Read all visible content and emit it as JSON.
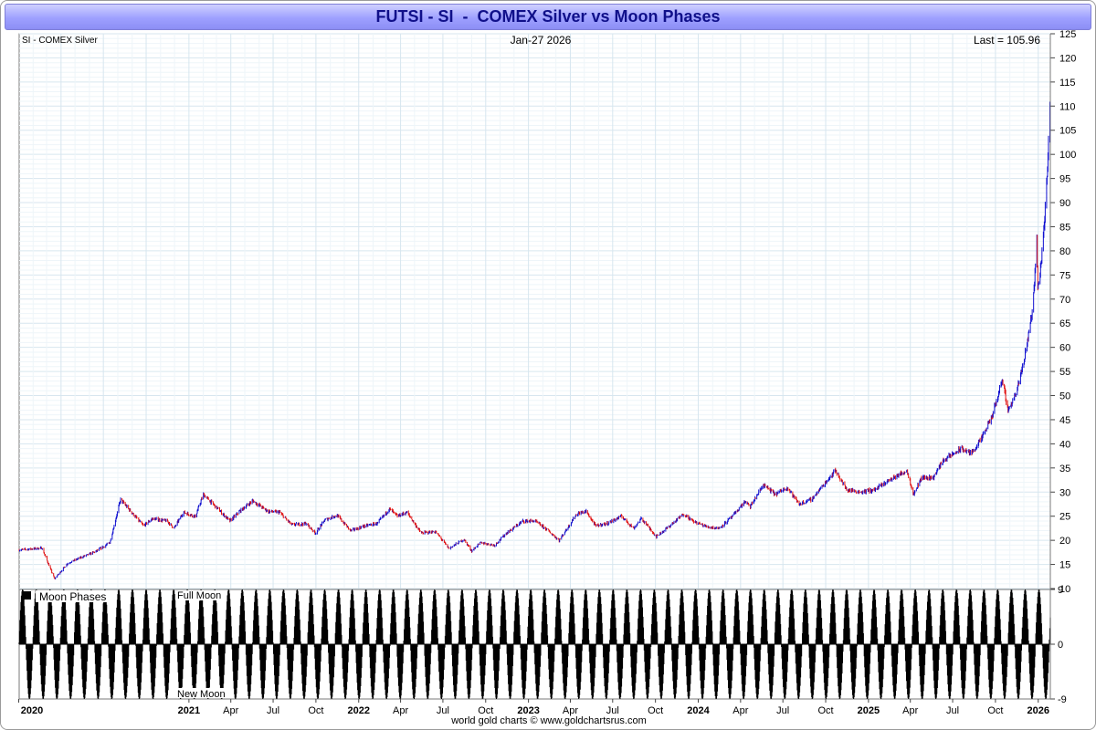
{
  "title": "FUTSI - SI  -  COMEX Silver vs Moon Phases",
  "footer": "world gold charts © www.goldchartsrus.com",
  "chart_data": [
    {
      "type": "line",
      "header_left": "SI  -  COMEX Silver",
      "header_center": "Jan-27  2026",
      "header_right": "Last = 105.96",
      "x_range": [
        "2020-01-02",
        "2026-01-27"
      ],
      "ylim": [
        10,
        125
      ],
      "y_ticks": [
        10,
        15,
        20,
        25,
        30,
        35,
        40,
        45,
        50,
        55,
        60,
        65,
        70,
        75,
        80,
        85,
        90,
        95,
        100,
        105,
        110,
        115,
        120,
        125
      ],
      "grid": true,
      "series_colors": {
        "up": "#1010d0",
        "down": "#e01010"
      },
      "series": [
        {
          "points": [
            [
              "2020-01-02",
              18.0
            ],
            [
              "2020-02-20",
              18.4
            ],
            [
              "2020-03-18",
              12.0
            ],
            [
              "2020-04-15",
              15.2
            ],
            [
              "2020-05-15",
              16.5
            ],
            [
              "2020-06-15",
              17.7
            ],
            [
              "2020-07-15",
              19.5
            ],
            [
              "2020-08-07",
              28.5
            ],
            [
              "2020-08-20",
              27.0
            ],
            [
              "2020-09-25",
              23.0
            ],
            [
              "2020-10-15",
              24.5
            ],
            [
              "2020-11-15",
              24.0
            ],
            [
              "2020-11-30",
              22.5
            ],
            [
              "2020-12-20",
              25.8
            ],
            [
              "2021-01-15",
              25.0
            ],
            [
              "2021-02-01",
              29.5
            ],
            [
              "2021-02-22",
              27.5
            ],
            [
              "2021-03-30",
              24.0
            ],
            [
              "2021-04-20",
              26.0
            ],
            [
              "2021-05-18",
              28.2
            ],
            [
              "2021-06-20",
              26.0
            ],
            [
              "2021-07-15",
              25.8
            ],
            [
              "2021-08-10",
              23.2
            ],
            [
              "2021-09-10",
              23.5
            ],
            [
              "2021-09-30",
              21.5
            ],
            [
              "2021-10-20",
              24.2
            ],
            [
              "2021-11-15",
              25.2
            ],
            [
              "2021-12-15",
              22.0
            ],
            [
              "2022-01-15",
              23.0
            ],
            [
              "2022-02-10",
              23.5
            ],
            [
              "2022-03-08",
              26.5
            ],
            [
              "2022-03-25",
              25.0
            ],
            [
              "2022-04-15",
              25.8
            ],
            [
              "2022-05-15",
              21.5
            ],
            [
              "2022-06-15",
              21.8
            ],
            [
              "2022-07-14",
              18.3
            ],
            [
              "2022-08-15",
              20.2
            ],
            [
              "2022-09-01",
              17.8
            ],
            [
              "2022-09-20",
              19.5
            ],
            [
              "2022-10-20",
              19.0
            ],
            [
              "2022-11-15",
              21.5
            ],
            [
              "2022-12-20",
              24.0
            ],
            [
              "2023-01-15",
              24.0
            ],
            [
              "2023-02-10",
              22.2
            ],
            [
              "2023-03-08",
              20.0
            ],
            [
              "2023-04-15",
              25.5
            ],
            [
              "2023-05-05",
              26.0
            ],
            [
              "2023-05-25",
              23.0
            ],
            [
              "2023-06-20",
              23.5
            ],
            [
              "2023-07-20",
              25.0
            ],
            [
              "2023-08-15",
              22.5
            ],
            [
              "2023-09-01",
              24.5
            ],
            [
              "2023-10-03",
              20.8
            ],
            [
              "2023-11-01",
              23.0
            ],
            [
              "2023-12-01",
              25.5
            ],
            [
              "2023-12-20",
              24.0
            ],
            [
              "2024-01-20",
              22.8
            ],
            [
              "2024-02-15",
              22.5
            ],
            [
              "2024-03-15",
              25.0
            ],
            [
              "2024-04-10",
              28.0
            ],
            [
              "2024-04-22",
              27.0
            ],
            [
              "2024-05-20",
              31.5
            ],
            [
              "2024-06-15",
              29.5
            ],
            [
              "2024-07-10",
              31.0
            ],
            [
              "2024-08-05",
              27.5
            ],
            [
              "2024-09-01",
              28.5
            ],
            [
              "2024-10-22",
              34.5
            ],
            [
              "2024-11-15",
              30.5
            ],
            [
              "2024-12-15",
              30.0
            ],
            [
              "2025-01-15",
              30.5
            ],
            [
              "2025-02-15",
              32.5
            ],
            [
              "2025-03-25",
              34.5
            ],
            [
              "2025-04-08",
              29.5
            ],
            [
              "2025-04-25",
              33.0
            ],
            [
              "2025-05-20",
              33.0
            ],
            [
              "2025-06-10",
              36.5
            ],
            [
              "2025-07-20",
              39.0
            ],
            [
              "2025-08-10",
              38.0
            ],
            [
              "2025-09-01",
              41.0
            ],
            [
              "2025-09-25",
              46.0
            ],
            [
              "2025-10-16",
              53.5
            ],
            [
              "2025-10-28",
              47.0
            ],
            [
              "2025-11-15",
              50.5
            ],
            [
              "2025-12-01",
              57.0
            ],
            [
              "2025-12-20",
              68.0
            ],
            [
              "2025-12-29",
              82.0
            ],
            [
              "2025-12-31",
              72.0
            ],
            [
              "2026-01-10",
              80.0
            ],
            [
              "2026-01-20",
              95.0
            ],
            [
              "2026-01-26",
              110.0
            ],
            [
              "2026-01-27",
              105.96
            ]
          ]
        }
      ]
    },
    {
      "type": "area",
      "legend": "Moon Phases",
      "label_top": "Full Moon",
      "label_bottom": "New Moon",
      "ylim": [
        -9,
        9
      ],
      "y_ticks": [
        9,
        0,
        -9
      ],
      "series_colors": {
        "fill": "#000000"
      },
      "phase_reference_new_moon": "2020-01-24",
      "synodic_period_days": 29.53,
      "amplitude": 9
    }
  ],
  "x_axis": {
    "labels": [
      {
        "date": "2020-01-01",
        "text": "2020",
        "bold": true
      },
      {
        "date": "2021-01-01",
        "text": "2021",
        "bold": true
      },
      {
        "date": "2021-04-01",
        "text": "Apr",
        "bold": false
      },
      {
        "date": "2021-07-01",
        "text": "Jul",
        "bold": false
      },
      {
        "date": "2021-10-01",
        "text": "Oct",
        "bold": false
      },
      {
        "date": "2022-01-01",
        "text": "2022",
        "bold": true
      },
      {
        "date": "2022-04-01",
        "text": "Apr",
        "bold": false
      },
      {
        "date": "2022-07-01",
        "text": "Jul",
        "bold": false
      },
      {
        "date": "2022-10-01",
        "text": "Oct",
        "bold": false
      },
      {
        "date": "2023-01-01",
        "text": "2023",
        "bold": true
      },
      {
        "date": "2023-04-01",
        "text": "Apr",
        "bold": false
      },
      {
        "date": "2023-07-01",
        "text": "Jul",
        "bold": false
      },
      {
        "date": "2023-10-01",
        "text": "Oct",
        "bold": false
      },
      {
        "date": "2024-01-01",
        "text": "2024",
        "bold": true
      },
      {
        "date": "2024-04-01",
        "text": "Apr",
        "bold": false
      },
      {
        "date": "2024-07-01",
        "text": "Jul",
        "bold": false
      },
      {
        "date": "2024-10-01",
        "text": "Oct",
        "bold": false
      },
      {
        "date": "2025-01-01",
        "text": "2025",
        "bold": true
      },
      {
        "date": "2025-04-01",
        "text": "Apr",
        "bold": false
      },
      {
        "date": "2025-07-01",
        "text": "Jul",
        "bold": false
      },
      {
        "date": "2025-10-01",
        "text": "Oct",
        "bold": false
      },
      {
        "date": "2026-01-01",
        "text": "2026",
        "bold": true
      }
    ]
  }
}
